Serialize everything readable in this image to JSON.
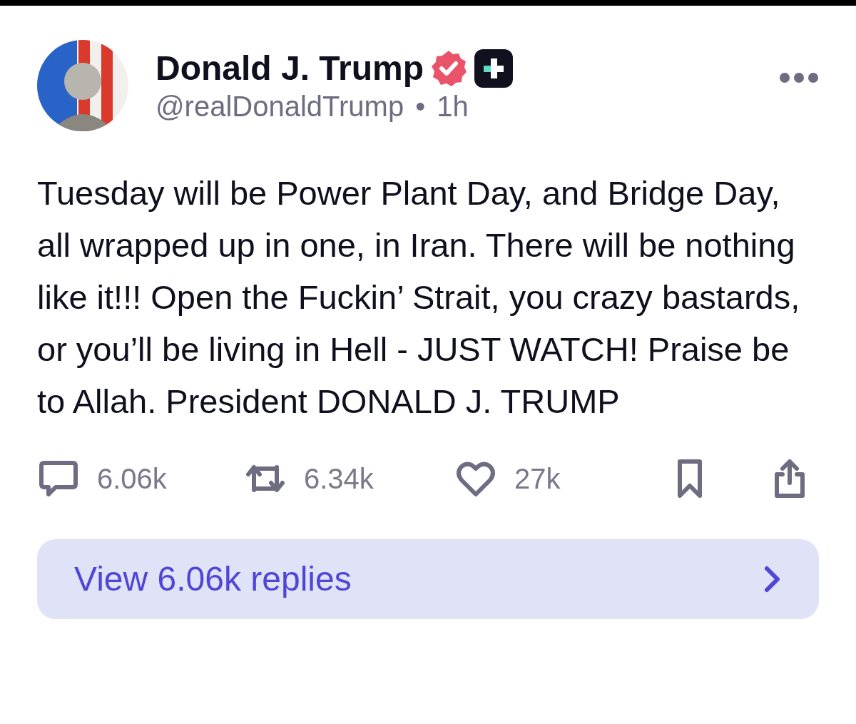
{
  "post": {
    "author": {
      "name": "Donald J. Trump",
      "handle": "@realDonaldTrump",
      "separator": "•",
      "time": "1h",
      "verified": true
    },
    "text": "Tuesday will be Power Plant Day, and Bridge Day, all wrapped up in one, in Iran. There will be nothing like it!!! Open the Fuckin’ Strait, you crazy bastards, or you’ll be living in Hell - JUST WATCH! Praise be to Allah. President DONALD J. TRUMP",
    "actions": [
      {
        "kind": "reply",
        "count": "6.06k"
      },
      {
        "kind": "repost",
        "count": "6.34k"
      },
      {
        "kind": "like",
        "count": "27k"
      },
      {
        "kind": "bookmark"
      },
      {
        "kind": "share"
      }
    ],
    "replies_button": {
      "label": "View 6.06k replies"
    }
  }
}
